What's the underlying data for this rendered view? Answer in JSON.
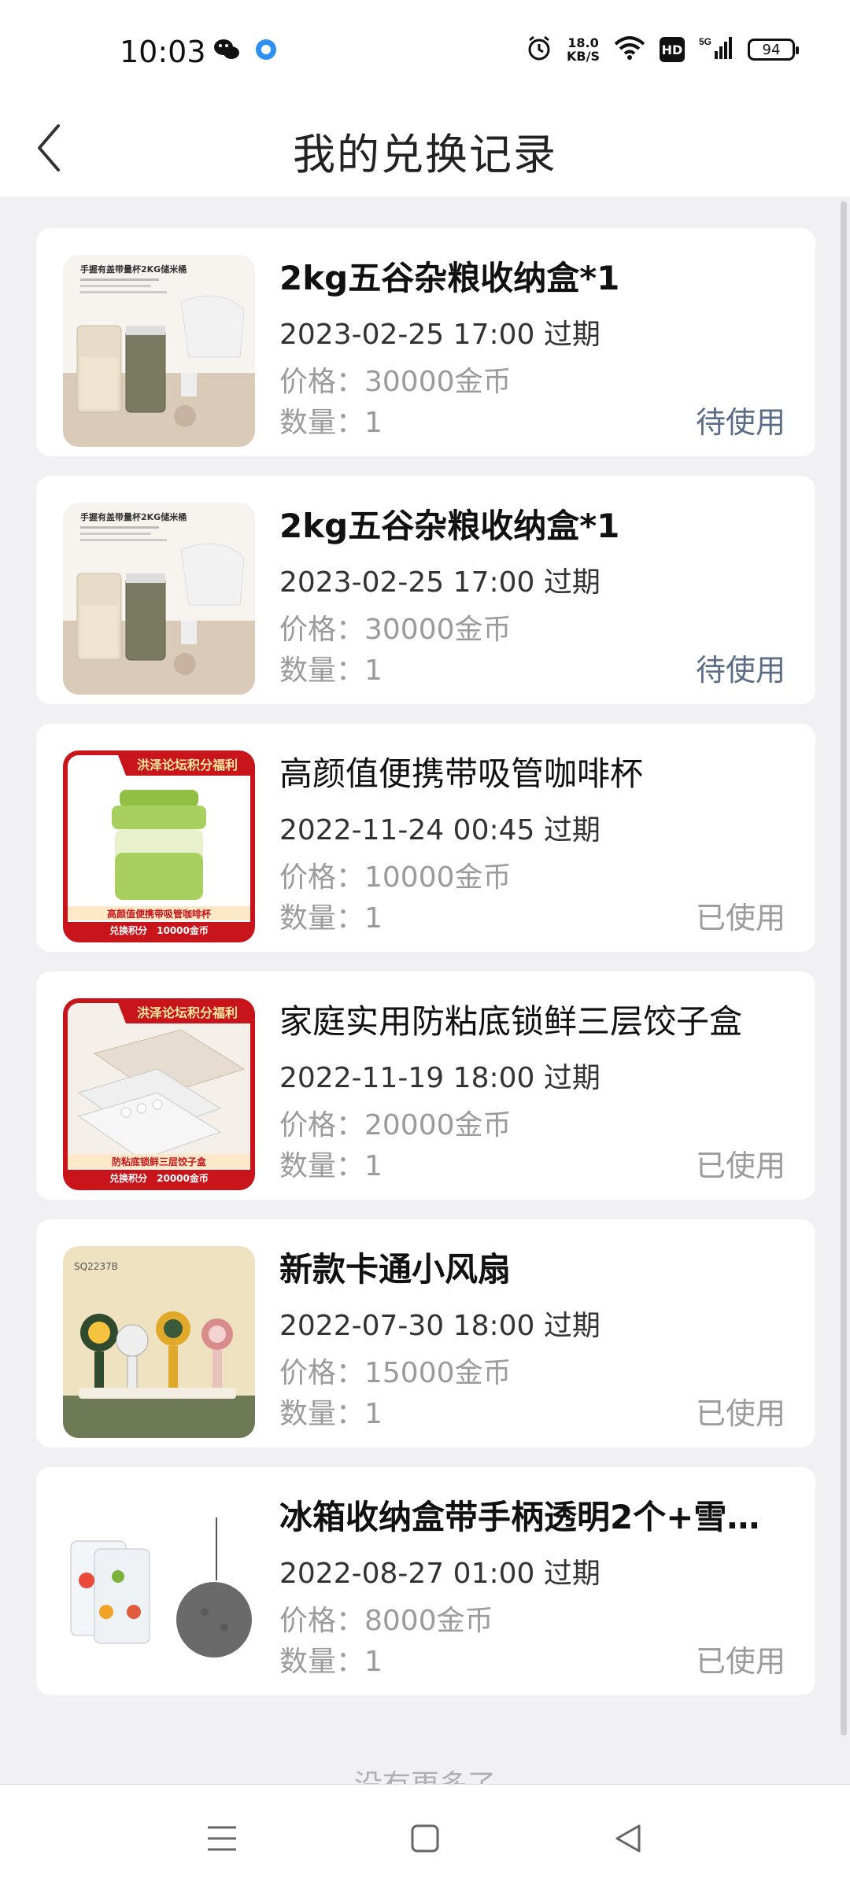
{
  "status_bar": {
    "time": "10:03",
    "speed_value": "18.0",
    "speed_unit": "KB/S",
    "hd_label": "HD",
    "battery": "94",
    "icons": [
      "wechat-icon",
      "app-notification-icon",
      "alarm-icon",
      "wifi-icon",
      "signal-5g-icon"
    ]
  },
  "header": {
    "title": "我的兑换记录",
    "back_icon": "chevron-left-icon"
  },
  "records": [
    {
      "title": "2kg五谷杂粮收纳盒*1",
      "expiry": "2023-02-25 17:00 过期",
      "price": "价格：30000金币",
      "quantity": "数量：1",
      "status": "待使用",
      "thumb_caption": "手握有盖带量杯2KG储米桶"
    },
    {
      "title": "2kg五谷杂粮收纳盒*1",
      "expiry": "2023-02-25 17:00 过期",
      "price": "价格：30000金币",
      "quantity": "数量：1",
      "status": "待使用",
      "thumb_caption": "手握有盖带量杯2KG储米桶"
    },
    {
      "title": "高颜值便携带吸管咖啡杯",
      "expiry": "2022-11-24 00:45 过期",
      "price": "价格：10000金币",
      "quantity": "数量：1",
      "status": "已使用",
      "thumb_banner": "洪泽论坛积分福利",
      "thumb_caption": "高颜值便携带吸管咖啡杯",
      "thumb_footer": "兑换积分　10000金币"
    },
    {
      "title": "家庭实用防粘底锁鲜三层饺子盒",
      "expiry": "2022-11-19 18:00 过期",
      "price": "价格：20000金币",
      "quantity": "数量：1",
      "status": "已使用",
      "thumb_banner": "洪泽论坛积分福利",
      "thumb_caption": "防粘底锁鲜三层饺子盒",
      "thumb_footer": "兑换积分　20000金币"
    },
    {
      "title": "新款卡通小风扇",
      "expiry": "2022-07-30 18:00 过期",
      "price": "价格：15000金币",
      "quantity": "数量：1",
      "status": "已使用",
      "thumb_caption": "SQ2237B"
    },
    {
      "title": "冰箱收纳盒带手柄透明2个+雪尼...",
      "expiry": "2022-08-27 01:00 过期",
      "price": "价格：8000金币",
      "quantity": "数量：1",
      "status": "已使用"
    }
  ],
  "footer_text": "没有更多了",
  "nav": {
    "icons": [
      "menu-icon",
      "home-square-icon",
      "back-triangle-icon"
    ]
  },
  "colors": {
    "pending_status": "#5b6c86",
    "used_status": "#9b9b9b",
    "background": "#f1f1f3",
    "banner_red": "#c8151b"
  }
}
